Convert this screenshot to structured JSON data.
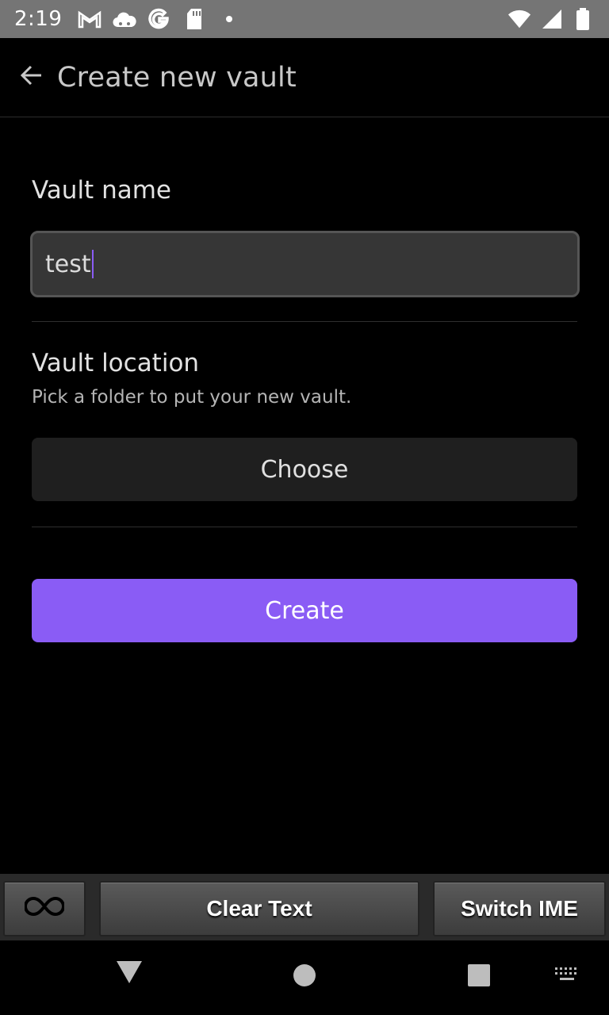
{
  "status_bar": {
    "time": "2:19",
    "left_icons": [
      "gmail-icon",
      "cloud-icon",
      "google-icon",
      "sd-card-icon",
      "dot-icon"
    ],
    "right_icons": [
      "wifi-icon",
      "signal-icon",
      "battery-icon"
    ]
  },
  "header": {
    "back_icon": "arrow-left-icon",
    "title": "Create new vault"
  },
  "vault_name": {
    "label": "Vault name",
    "value": "test"
  },
  "vault_location": {
    "label": "Vault location",
    "description": "Pick a folder to put your new vault.",
    "choose_label": "Choose"
  },
  "create_label": "Create",
  "ime_toolbar": {
    "infinity_icon": "infinity-icon",
    "clear_text_label": "Clear Text",
    "switch_ime_label": "Switch IME"
  },
  "nav_bar": {
    "icons": [
      "back-triangle-icon",
      "home-circle-icon",
      "recents-square-icon",
      "keyboard-icon"
    ]
  },
  "colors": {
    "accent": "#8a5cf5",
    "background": "#000000",
    "status_bar": "#757575"
  }
}
